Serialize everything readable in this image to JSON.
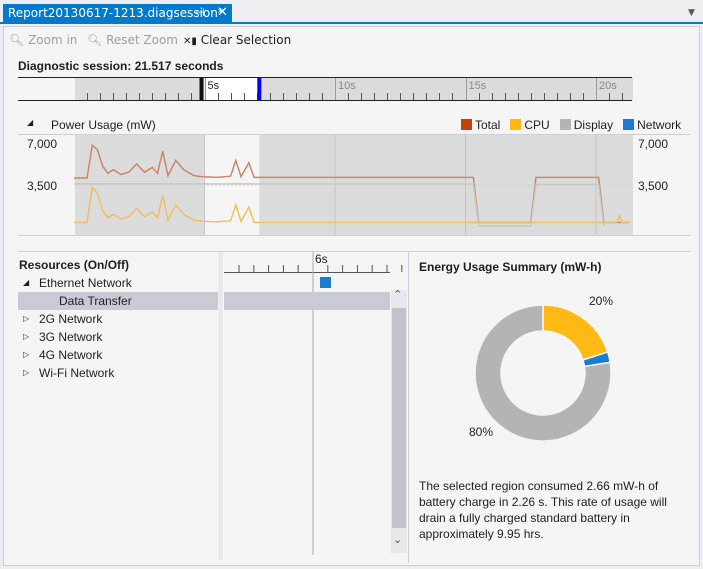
{
  "tab": {
    "title": "Report20130617-1213.diagsession*",
    "pin_icon": "pin-icon",
    "close_icon": "close-icon"
  },
  "toolbar": {
    "zoom_in": "Zoom in",
    "reset_zoom": "Reset Zoom",
    "clear_selection": "Clear Selection"
  },
  "session": {
    "label": "Diagnostic session: 21.517 seconds",
    "duration_s": 21.517,
    "selection_start_s": 5.0,
    "selection_end_s": 7.1
  },
  "ruler": {
    "ticks": [
      "5s",
      "10s",
      "15s",
      "20s"
    ]
  },
  "power": {
    "title": "Power Usage (mW)",
    "y_labels": [
      "7,000",
      "3,500"
    ],
    "legend": [
      {
        "label": "Total",
        "color": "#c1440e"
      },
      {
        "label": "CPU",
        "color": "#ffb914"
      },
      {
        "label": "Display",
        "color": "#b4b4b4"
      },
      {
        "label": "Network",
        "color": "#1a7bd3"
      }
    ]
  },
  "chart_data": {
    "type": "line",
    "title": "Power Usage (mW)",
    "ylim": [
      0,
      7000
    ],
    "xlim": [
      0,
      21.517
    ],
    "series": [
      {
        "name": "Total",
        "color": "#c8866a",
        "points": [
          [
            0,
            4100
          ],
          [
            0.5,
            4100
          ],
          [
            0.7,
            6900
          ],
          [
            0.9,
            6500
          ],
          [
            1.1,
            5100
          ],
          [
            1.3,
            4500
          ],
          [
            1.5,
            4800
          ],
          [
            1.8,
            4400
          ],
          [
            2.1,
            4600
          ],
          [
            2.4,
            5300
          ],
          [
            2.7,
            4600
          ],
          [
            3.0,
            5000
          ],
          [
            3.2,
            4500
          ],
          [
            3.4,
            6400
          ],
          [
            3.6,
            4300
          ],
          [
            3.9,
            5600
          ],
          [
            4.2,
            4800
          ],
          [
            4.6,
            4300
          ],
          [
            4.9,
            4200
          ],
          [
            5.5,
            4150
          ],
          [
            6.0,
            4250
          ],
          [
            6.2,
            5600
          ],
          [
            6.4,
            4200
          ],
          [
            6.7,
            5400
          ],
          [
            6.9,
            4150
          ],
          [
            15.3,
            4150
          ],
          [
            15.5,
            300
          ],
          [
            17.5,
            300
          ],
          [
            17.7,
            4150
          ],
          [
            20.1,
            4150
          ],
          [
            20.3,
            300
          ],
          [
            21.3,
            300
          ]
        ]
      },
      {
        "name": "Display",
        "color": "#c8c8c8",
        "points": [
          [
            0,
            3600
          ],
          [
            15.3,
            3600
          ],
          [
            15.5,
            0
          ],
          [
            17.5,
            0
          ],
          [
            17.7,
            3550
          ],
          [
            20.1,
            3550
          ],
          [
            20.3,
            0
          ]
        ]
      },
      {
        "name": "CPU",
        "color": "#f0c060",
        "points": [
          [
            0,
            300
          ],
          [
            0.5,
            300
          ],
          [
            0.7,
            3300
          ],
          [
            0.9,
            2800
          ],
          [
            1.1,
            1300
          ],
          [
            1.3,
            700
          ],
          [
            1.5,
            1000
          ],
          [
            1.8,
            600
          ],
          [
            2.1,
            800
          ],
          [
            2.4,
            1500
          ],
          [
            2.7,
            800
          ],
          [
            3.0,
            1200
          ],
          [
            3.2,
            700
          ],
          [
            3.4,
            2600
          ],
          [
            3.6,
            500
          ],
          [
            3.9,
            1800
          ],
          [
            4.2,
            1000
          ],
          [
            4.6,
            500
          ],
          [
            4.9,
            400
          ],
          [
            5.5,
            350
          ],
          [
            6.0,
            450
          ],
          [
            6.2,
            1800
          ],
          [
            6.4,
            400
          ],
          [
            6.7,
            1600
          ],
          [
            6.9,
            300
          ],
          [
            20.8,
            300
          ],
          [
            20.9,
            900
          ],
          [
            21.0,
            300
          ],
          [
            21.3,
            300
          ]
        ]
      }
    ]
  },
  "resources": {
    "title": "Resources (On/Off)",
    "tick": "6s",
    "items": [
      {
        "label": "Ethernet Network",
        "expanded": true,
        "level": 0
      },
      {
        "label": "Data Transfer",
        "level": 1,
        "selected": true
      },
      {
        "label": "2G Network",
        "level": 0
      },
      {
        "label": "3G Network",
        "level": 0
      },
      {
        "label": "4G Network",
        "level": 0
      },
      {
        "label": "Wi-Fi Network",
        "level": 0
      }
    ]
  },
  "summary": {
    "title": "Energy Usage Summary (mW-h)",
    "slices": [
      {
        "name": "CPU",
        "pct": 20,
        "color": "#ffb914"
      },
      {
        "name": "Network",
        "pct": 2.5,
        "color": "#1a7bd3"
      },
      {
        "name": "Display",
        "pct": 77.5,
        "color": "#b4b4b4"
      }
    ],
    "label_cpu": "20%",
    "label_display": "80%",
    "description": "The selected region consumed 2.66 mW-h of battery charge in 2.26 s. This rate of usage will drain a fully charged standard battery in approximately 9.95 hrs."
  }
}
